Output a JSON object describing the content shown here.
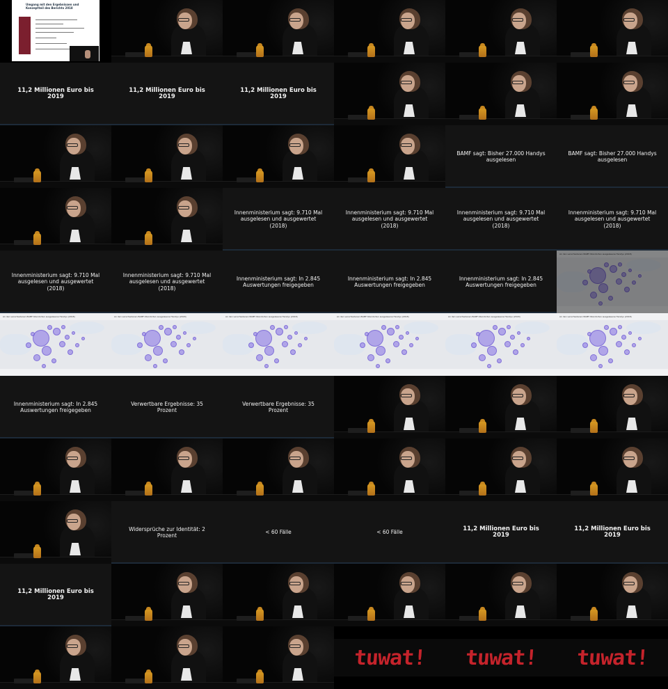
{
  "grid": {
    "columns": 6,
    "rows": 11
  },
  "cells": [
    {
      "type": "document",
      "name": "slide-document",
      "title": "Umgang mit den Ergebnissen und Konzeptteil des Berichts 2018"
    },
    {
      "type": "speaker"
    },
    {
      "type": "speaker"
    },
    {
      "type": "speaker"
    },
    {
      "type": "speaker"
    },
    {
      "type": "speaker"
    },
    {
      "type": "text",
      "text": "11,2 Millionen Euro bis 2019",
      "big": true
    },
    {
      "type": "text",
      "text": "11,2 Millionen Euro bis 2019",
      "big": true
    },
    {
      "type": "text",
      "text": "11,2 Millionen Euro bis 2019",
      "big": true
    },
    {
      "type": "speaker"
    },
    {
      "type": "speaker"
    },
    {
      "type": "speaker"
    },
    {
      "type": "speaker"
    },
    {
      "type": "speaker"
    },
    {
      "type": "speaker"
    },
    {
      "type": "speaker"
    },
    {
      "type": "text",
      "text": "BAMF sagt: Bisher 27.000 Handys ausgelesen"
    },
    {
      "type": "text",
      "text": "BAMF sagt: Bisher 27.000 Handys ausgelesen"
    },
    {
      "type": "speaker"
    },
    {
      "type": "speaker"
    },
    {
      "type": "text",
      "text": "Innenministerium sagt: 9.710 Mal ausgelesen und ausgewertet (2018)"
    },
    {
      "type": "text",
      "text": "Innenministerium sagt: 9.710 Mal ausgelesen und ausgewertet (2018)"
    },
    {
      "type": "text",
      "text": "Innenministerium sagt: 9.710 Mal ausgelesen und ausgewertet (2018)"
    },
    {
      "type": "text",
      "text": "Innenministerium sagt: 9.710 Mal ausgelesen und ausgewertet (2018)"
    },
    {
      "type": "text",
      "text": "Innenministerium sagt: 9.710 Mal ausgelesen und ausgewertet (2018)"
    },
    {
      "type": "text",
      "text": "Innenministerium sagt: 9.710 Mal ausgelesen und ausgewertet (2018)"
    },
    {
      "type": "text",
      "text": "Innenministerium sagt: In 2.845 Auswertungen freigegeben"
    },
    {
      "type": "text",
      "text": "Innenministerium sagt: In 2.845 Auswertungen freigegeben"
    },
    {
      "type": "text",
      "text": "Innenministerium sagt: In 2.845 Auswertungen freigegeben"
    },
    {
      "type": "map",
      "dim": true,
      "title": "An den verschiedenen BAMF-Standorten ausgelesene Handys (2018)"
    },
    {
      "type": "map",
      "title": "An den verschiedenen BAMF-Standorten ausgelesene Handys (2018)"
    },
    {
      "type": "map",
      "title": "An den verschiedenen BAMF-Standorten ausgelesene Handys (2018)"
    },
    {
      "type": "map",
      "title": "An den verschiedenen BAMF-Standorten ausgelesene Handys (2018)"
    },
    {
      "type": "map",
      "title": "An den verschiedenen BAMF-Standorten ausgelesene Handys (2018)"
    },
    {
      "type": "map",
      "title": "An den verschiedenen BAMF-Standorten ausgelesene Handys (2018)"
    },
    {
      "type": "map",
      "title": "An den verschiedenen BAMF-Standorten ausgelesene Handys (2018)"
    },
    {
      "type": "text",
      "text": "Innenministerium sagt: In 2.845 Auswertungen freigegeben"
    },
    {
      "type": "text",
      "text": "Verwertbare Ergebnisse: 35 Prozent"
    },
    {
      "type": "text",
      "text": "Verwertbare Ergebnisse: 35 Prozent"
    },
    {
      "type": "speaker"
    },
    {
      "type": "speaker"
    },
    {
      "type": "speaker"
    },
    {
      "type": "speaker"
    },
    {
      "type": "speaker"
    },
    {
      "type": "speaker"
    },
    {
      "type": "speaker"
    },
    {
      "type": "speaker"
    },
    {
      "type": "speaker"
    },
    {
      "type": "speaker"
    },
    {
      "type": "text",
      "text": "Widersprüche zur Identität: 2 Prozent"
    },
    {
      "type": "text",
      "text": "< 60 Fälle"
    },
    {
      "type": "text",
      "text": "< 60 Fälle"
    },
    {
      "type": "text",
      "text": "11,2 Millionen Euro bis 2019",
      "big": true
    },
    {
      "type": "text",
      "text": "11,2 Millionen Euro bis 2019",
      "big": true
    },
    {
      "type": "text",
      "text": "11,2 Millionen Euro bis 2019",
      "big": true
    },
    {
      "type": "speaker"
    },
    {
      "type": "speaker"
    },
    {
      "type": "speaker"
    },
    {
      "type": "speaker"
    },
    {
      "type": "speaker"
    },
    {
      "type": "speaker"
    },
    {
      "type": "speaker"
    },
    {
      "type": "speaker"
    },
    {
      "type": "logo",
      "text": "tuwat!"
    },
    {
      "type": "logo",
      "text": "tuwat!"
    },
    {
      "type": "logo",
      "text": "tuwat!"
    }
  ]
}
